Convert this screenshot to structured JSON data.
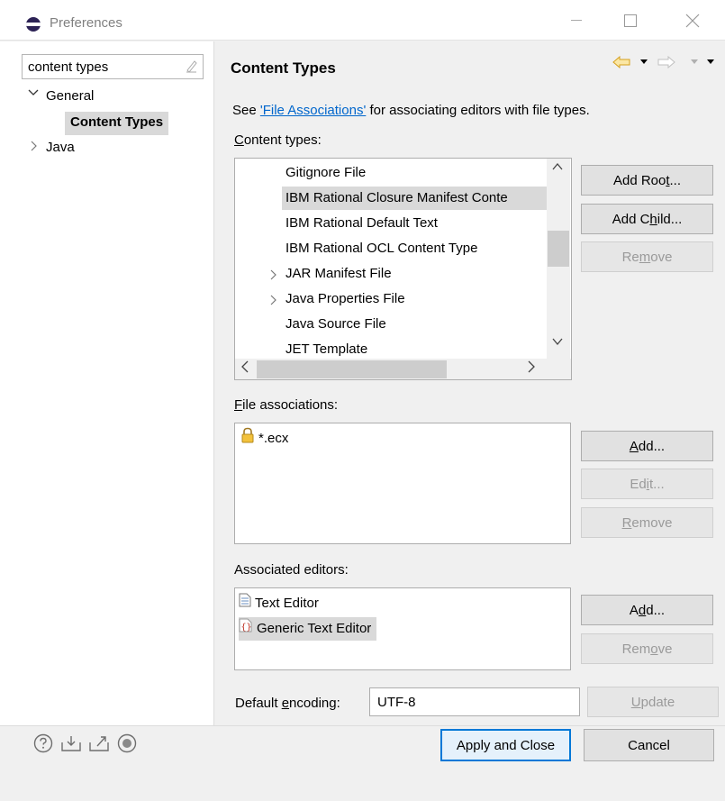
{
  "window": {
    "title": "Preferences"
  },
  "filter": {
    "value": "content types"
  },
  "tree": {
    "general": "General",
    "content_types": "Content Types",
    "java": "Java"
  },
  "page": {
    "title": "Content Types",
    "desc_prefix": "See ",
    "desc_link": "'File Associations'",
    "desc_suffix": " for associating editors with file types."
  },
  "content_types": {
    "label_mn": "C",
    "label_rest": "ontent types:",
    "items": [
      {
        "label": "Gitignore File",
        "expandable": false,
        "selected": false
      },
      {
        "label": "IBM Rational Closure Manifest Conte",
        "expandable": false,
        "selected": true
      },
      {
        "label": "IBM Rational Default Text",
        "expandable": false,
        "selected": false
      },
      {
        "label": "IBM Rational OCL Content Type",
        "expandable": false,
        "selected": false
      },
      {
        "label": "JAR Manifest File",
        "expandable": true,
        "selected": false
      },
      {
        "label": "Java Properties File",
        "expandable": true,
        "selected": false
      },
      {
        "label": "Java Source File",
        "expandable": false,
        "selected": false
      },
      {
        "label": "JET Template",
        "expandable": false,
        "selected": false
      }
    ],
    "add_root_pre": "Add Roo",
    "add_root_mn": "t",
    "add_root_post": "...",
    "add_child_pre": "Add C",
    "add_child_mn": "h",
    "add_child_post": "ild...",
    "remove_pre": "Re",
    "remove_mn": "m",
    "remove_post": "ove"
  },
  "file_associations": {
    "label_mn": "F",
    "label_rest": "ile associations:",
    "items": [
      {
        "label": "*.ecx",
        "icon": "lock-icon"
      }
    ],
    "add_mn": "A",
    "add_post": "dd...",
    "edit_pre": "Ed",
    "edit_mn": "i",
    "edit_post": "t...",
    "remove_mn": "R",
    "remove_post": "emove"
  },
  "associated_editors": {
    "label": "Associated editors:",
    "items": [
      {
        "label": "Text Editor",
        "icon": "text-file-icon",
        "selected": false
      },
      {
        "label": "Generic Text Editor",
        "icon": "generic-editor-icon",
        "selected": true
      }
    ],
    "add_pre": "A",
    "add_mn": "d",
    "add_post": "d...",
    "remove_pre": "Rem",
    "remove_mn": "o",
    "remove_post": "ve"
  },
  "encoding": {
    "label_pre": "Default ",
    "label_mn": "e",
    "label_post": "ncoding:",
    "value": "UTF-8",
    "update_mn": "U",
    "update_post": "pdate"
  },
  "footer": {
    "apply_close": "Apply and Close",
    "cancel": "Cancel"
  },
  "colors": {
    "link": "#0066cc",
    "default_button_border": "#0078d7",
    "selection": "#d9d9d9"
  }
}
